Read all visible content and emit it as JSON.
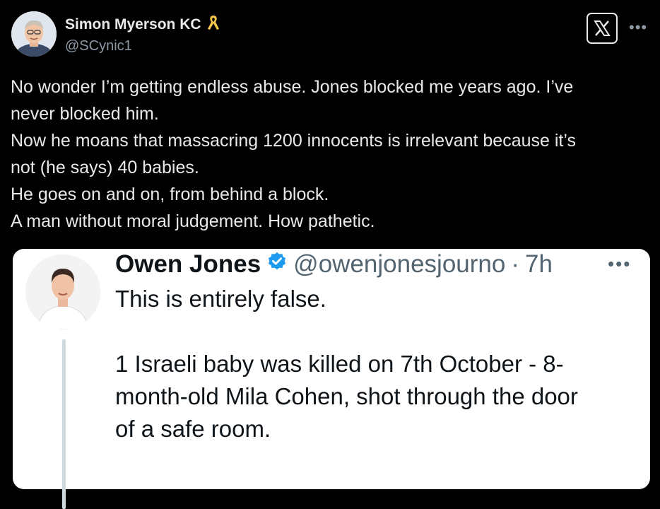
{
  "author": {
    "name": "Simon Myerson KC",
    "handle": "@SCynic1",
    "ribbon_icon": "yellow-ribbon-icon",
    "ribbon_color": "#f5c84c"
  },
  "tweet": {
    "lines": [
      "No wonder I’m getting endless abuse. Jones blocked me years ago. I’ve",
      "never blocked him.",
      "Now he moans that massacring 1200 innocents is irrelevant because it’s",
      "not (he says) 40 babies.",
      "He goes on and on, from behind a block.",
      "A man without moral judgement. How pathetic."
    ]
  },
  "quote": {
    "name": "Owen Jones",
    "verified_icon": "verified-badge-icon",
    "verified_color": "#1d9bf0",
    "handle": "@owenjonesjourno",
    "separator": "·",
    "time": "7h",
    "more": "•••",
    "lines": [
      "This is entirely false.",
      "",
      "1 Israeli baby was killed on 7th October - 8-",
      "month-old Mila Cohen, shot through the door",
      "of a safe room."
    ]
  },
  "toolbar": {
    "x_icon": "x-logo-icon",
    "more": "•••"
  }
}
